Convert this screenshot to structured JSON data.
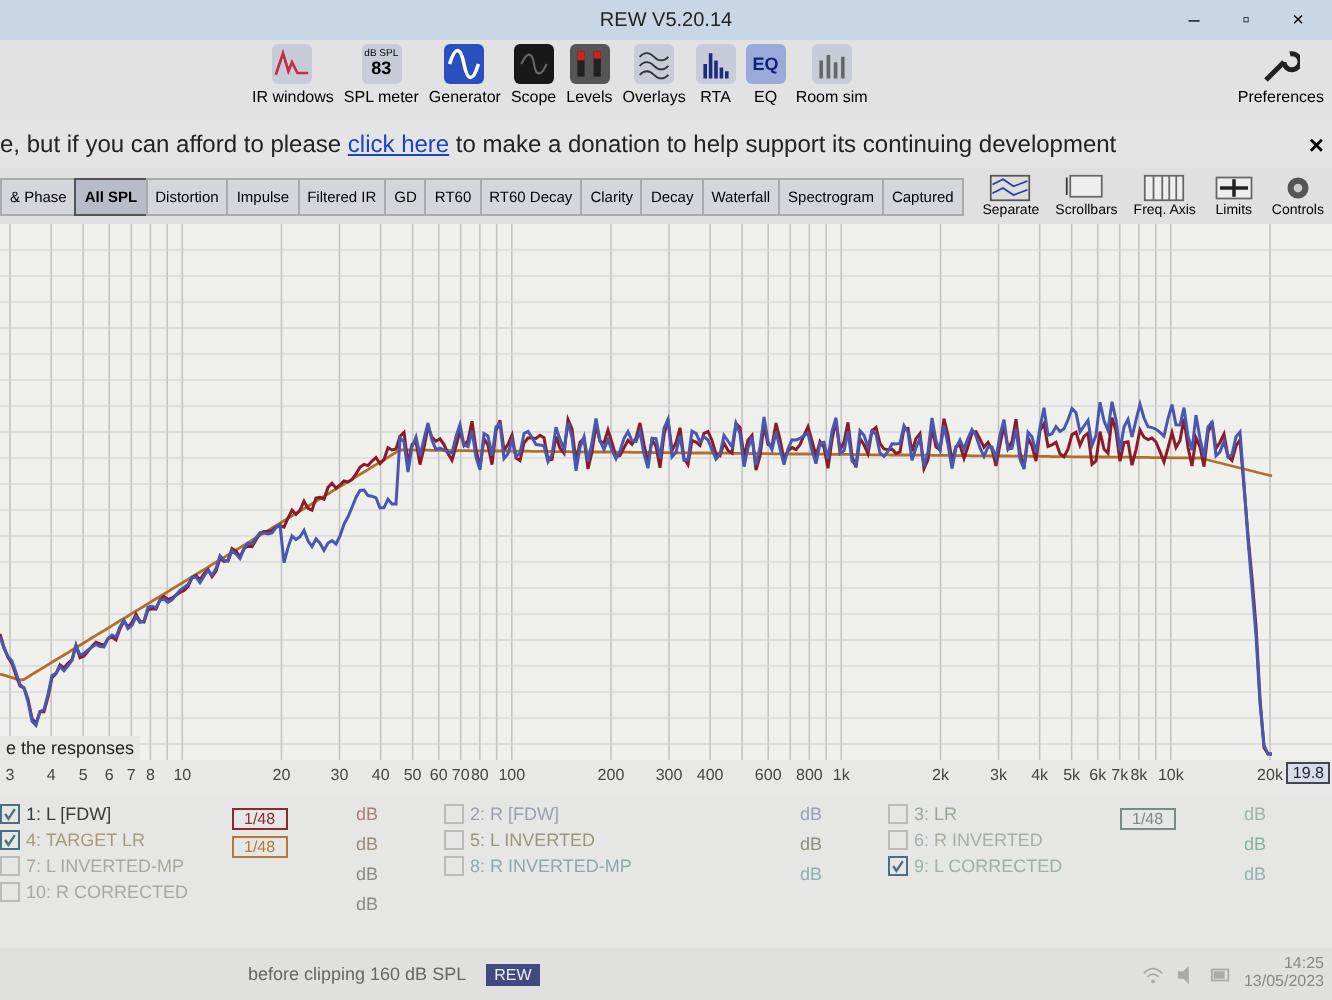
{
  "window": {
    "title": "REW V5.20.14",
    "controls": [
      "–",
      "▫",
      "×"
    ]
  },
  "toolbar": [
    {
      "label": "IR windows",
      "kind": "ir"
    },
    {
      "label": "SPL meter",
      "kind": "spl",
      "icon_text": [
        "dB SPL",
        "83"
      ]
    },
    {
      "label": "Generator",
      "kind": "gen"
    },
    {
      "label": "Scope",
      "kind": "scope"
    },
    {
      "label": "Levels",
      "kind": "levels"
    },
    {
      "label": "Overlays",
      "kind": "overlays"
    },
    {
      "label": "RTA",
      "kind": "rta"
    },
    {
      "label": "EQ",
      "kind": "eq",
      "icon_text": [
        "EQ"
      ]
    },
    {
      "label": "Room sim",
      "kind": "room"
    }
  ],
  "preferences": {
    "label": "Preferences"
  },
  "banner": {
    "before": "e, but if you can afford to please",
    "link": "click here",
    "after": "to make a donation to help support its continuing development",
    "close": "×"
  },
  "tabs": [
    {
      "label": "& Phase",
      "selected": false
    },
    {
      "label": "All SPL",
      "selected": true
    },
    {
      "label": "Distortion",
      "selected": false
    },
    {
      "label": "Impulse",
      "selected": false
    },
    {
      "label": "Filtered IR",
      "selected": false
    },
    {
      "label": "GD",
      "selected": false
    },
    {
      "label": "RT60",
      "selected": false
    },
    {
      "label": "RT60 Decay",
      "selected": false
    },
    {
      "label": "Clarity",
      "selected": false
    },
    {
      "label": "Decay",
      "selected": false
    },
    {
      "label": "Waterfall",
      "selected": false
    },
    {
      "label": "Spectrogram",
      "selected": false
    },
    {
      "label": "Captured",
      "selected": false
    }
  ],
  "graph_tools": [
    {
      "label": "Separate",
      "kind": "separate"
    },
    {
      "label": "Scrollbars",
      "kind": "scrollbars"
    },
    {
      "label": "Freq. Axis",
      "kind": "freq"
    },
    {
      "label": "Limits",
      "kind": "limits"
    },
    {
      "label": "Controls",
      "kind": "controls"
    }
  ],
  "graph": {
    "hint": "e the responses",
    "readout": "19.8",
    "ticks": [
      {
        "label": "3"
      },
      {
        "label": "4"
      },
      {
        "label": "5"
      },
      {
        "label": "6"
      },
      {
        "label": "7"
      },
      {
        "label": "8"
      },
      {
        "label": "10"
      },
      {
        "label": "20"
      },
      {
        "label": "30"
      },
      {
        "label": "40"
      },
      {
        "label": "50"
      },
      {
        "label": "60"
      },
      {
        "label": "70"
      },
      {
        "label": "80"
      },
      {
        "label": "100"
      },
      {
        "label": "200"
      },
      {
        "label": "300"
      },
      {
        "label": "400"
      },
      {
        "label": "600"
      },
      {
        "label": "800"
      },
      {
        "label": "1k"
      },
      {
        "label": "2k"
      },
      {
        "label": "3k"
      },
      {
        "label": "4k"
      },
      {
        "label": "5k"
      },
      {
        "label": "6k"
      },
      {
        "label": "7k"
      },
      {
        "label": "8k"
      },
      {
        "label": "10k"
      },
      {
        "label": "20k"
      }
    ]
  },
  "legend": [
    {
      "items": [
        {
          "label": "1: L [FDW]",
          "checked": true,
          "color": "#3a3a3a"
        },
        {
          "label": "4: TARGET LR",
          "checked": true,
          "color": "#a89a7a"
        },
        {
          "label": "7: L INVERTED-MP",
          "checked": false,
          "color": "#a8a8a0"
        },
        {
          "label": "10: R CORRECTED",
          "checked": false,
          "color": "#a8a8a0"
        }
      ],
      "filters": [
        {
          "label": "1/48",
          "color": "#8b2a32"
        },
        {
          "label": "1/48",
          "color": "#b07a3a"
        }
      ],
      "units": [
        {
          "label": "dB",
          "color": "#b07a7a"
        },
        {
          "label": "dB",
          "color": "#9a8a78"
        },
        {
          "label": "dB",
          "color": "#8a8a8a"
        },
        {
          "label": "dB",
          "color": "#8a8a8a"
        }
      ]
    },
    {
      "items": [
        {
          "label": "2: R [FDW]",
          "checked": false,
          "color": "#9aa0b0"
        },
        {
          "label": "5: L INVERTED",
          "checked": false,
          "color": "#9a9678"
        },
        {
          "label": "8: R INVERTED-MP",
          "checked": false,
          "color": "#8aaab0"
        }
      ],
      "units": [
        {
          "label": "dB",
          "color": "#9aa0b8"
        },
        {
          "label": "dB",
          "color": "#8e8e7c"
        },
        {
          "label": "dB",
          "color": "#8ab0b8"
        }
      ]
    },
    {
      "items": [
        {
          "label": "3: LR",
          "checked": false,
          "color": "#9aa898"
        },
        {
          "label": "6: R INVERTED",
          "checked": false,
          "color": "#a8b0a0"
        },
        {
          "label": "9: L CORRECTED",
          "checked": true,
          "color": "#9ab0a8"
        }
      ],
      "filters": [
        {
          "label": "1/48",
          "color": "#7a8a8a"
        }
      ],
      "units": [
        {
          "label": "dB",
          "color": "#9ab8a8"
        },
        {
          "label": "dB",
          "color": "#8ab0a0"
        },
        {
          "label": "dB",
          "color": "#9ab0b0"
        }
      ]
    }
  ],
  "status": {
    "text": "before clipping 160 dB SPL",
    "taskbar_app": "REW",
    "time": "14:25",
    "date": "13/05/2023"
  }
}
